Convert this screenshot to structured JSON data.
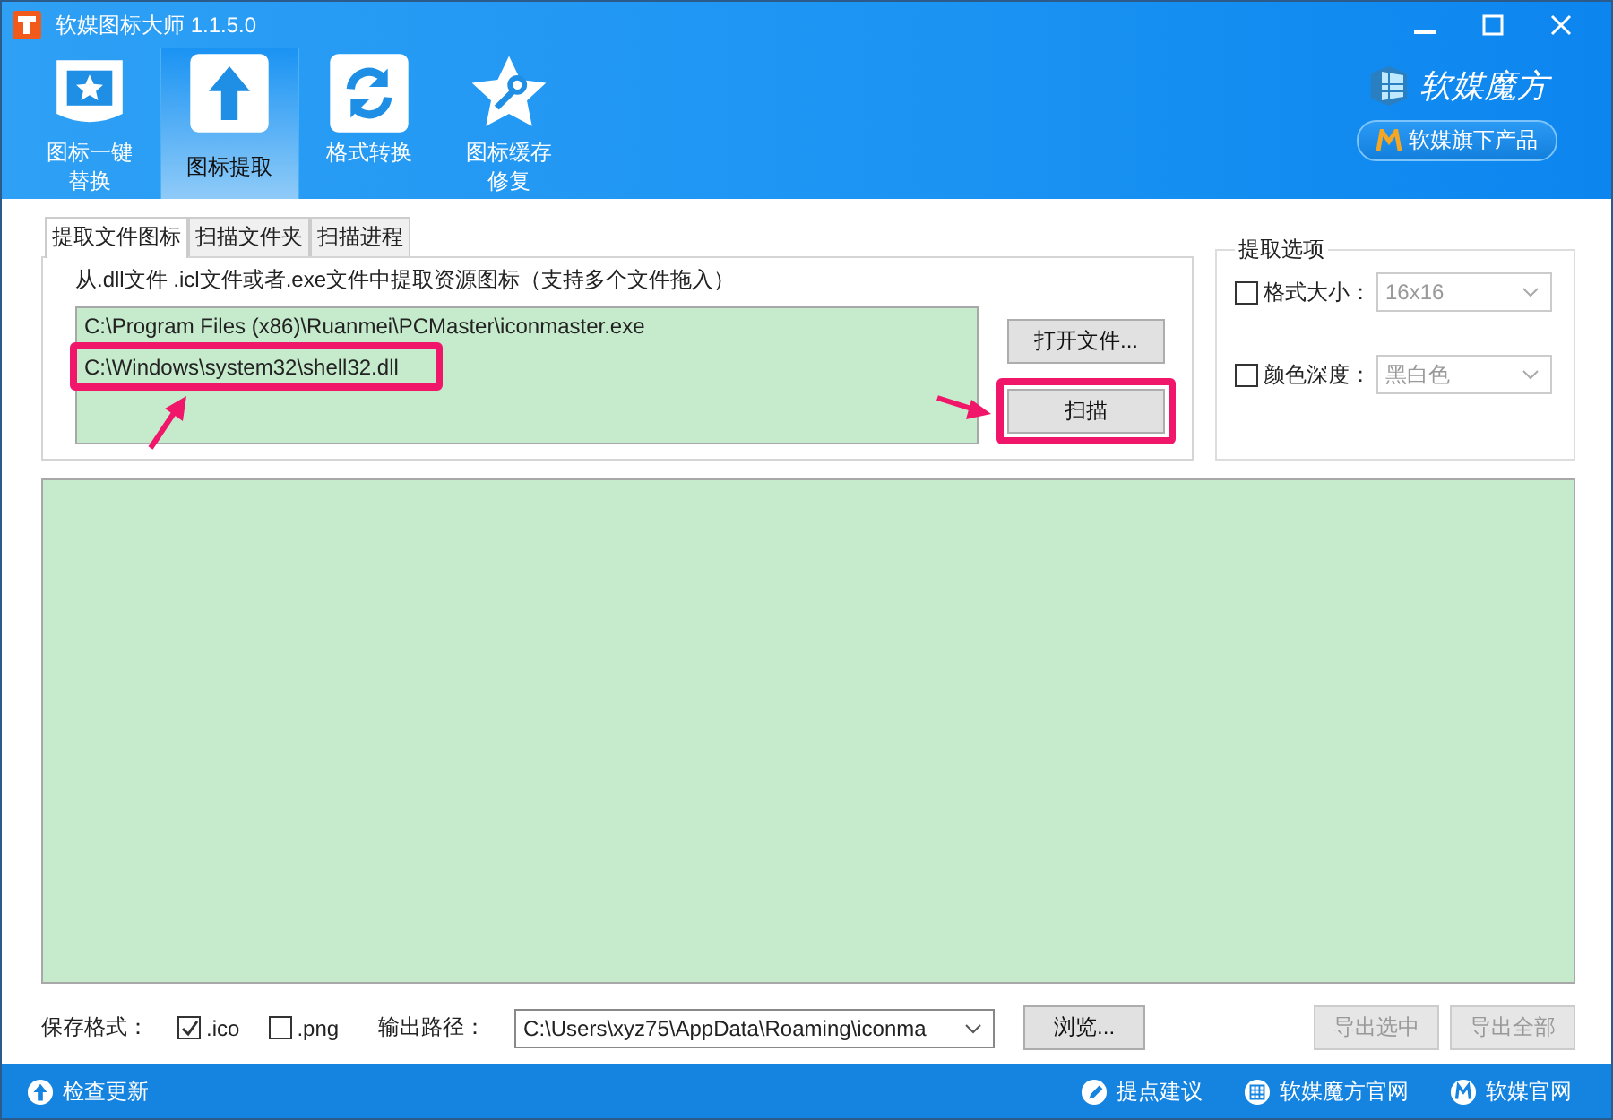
{
  "window": {
    "title": "软媒图标大师 1.1.5.0"
  },
  "toolbar": [
    {
      "label": "图标一键替换",
      "kind": "screen",
      "selected": false
    },
    {
      "label": "图标提取",
      "kind": "upload",
      "selected": true
    },
    {
      "label": "格式转换",
      "kind": "refresh",
      "selected": false
    },
    {
      "label": "图标缓存修复",
      "kind": "star",
      "selected": false
    }
  ],
  "brand": {
    "name": "软媒魔方",
    "products_button": "软媒旗下产品"
  },
  "tabs": [
    {
      "label": "提取文件图标",
      "selected": true
    },
    {
      "label": "扫描文件夹",
      "selected": false
    },
    {
      "label": "扫描进程",
      "selected": false
    }
  ],
  "hint": "从.dll文件 .icl文件或者.exe文件中提取资源图标（支持多个文件拖入）",
  "files": [
    "C:\\Program Files (x86)\\Ruanmei\\PCMaster\\iconmaster.exe",
    "C:\\Windows\\system32\\shell32.dll"
  ],
  "open_button": "打开文件...",
  "scan_button": "扫描",
  "options": {
    "title": "提取选项",
    "rows": [
      {
        "label": "格式大小：",
        "checked": false,
        "value": "16x16"
      },
      {
        "label": "颜色深度：",
        "checked": false,
        "value": "黑白色"
      }
    ]
  },
  "save": {
    "label": "保存格式：",
    "formats": [
      {
        "label": ".ico",
        "checked": true
      },
      {
        "label": ".png",
        "checked": false
      }
    ],
    "path_label": "输出路径：",
    "path": "C:\\Users\\xyz75\\AppData\\Roaming\\iconma",
    "browse": "浏览...",
    "actions": [
      {
        "label": "导出选中",
        "disabled": true
      },
      {
        "label": "导出全部",
        "disabled": true
      }
    ]
  },
  "status_bar": {
    "update": "检查更新",
    "links": [
      {
        "label": "提点建议",
        "kind": "pen"
      },
      {
        "label": "软媒魔方官网",
        "kind": "grid"
      },
      {
        "label": "软媒官网",
        "kind": "m"
      }
    ]
  }
}
